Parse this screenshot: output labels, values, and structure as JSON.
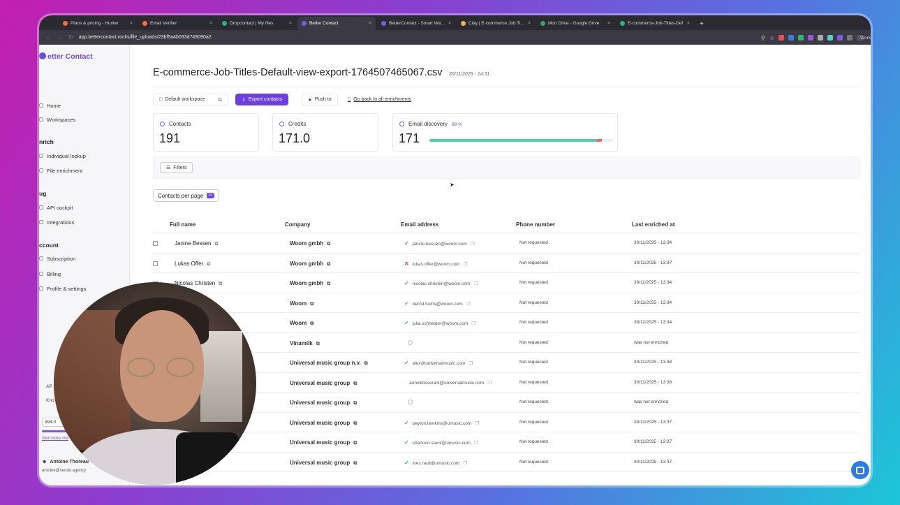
{
  "browser": {
    "tabs": [
      {
        "label": "Plans & pricing - Hunter",
        "color": "#ff6b3d",
        "active": false
      },
      {
        "label": "Email Verifier",
        "color": "#ff6b3d",
        "active": false
      },
      {
        "label": "Dropcontact | My files",
        "color": "#25b37a",
        "active": false
      },
      {
        "label": "Better Contact",
        "color": "#7b5ce6",
        "active": true
      },
      {
        "label": "BetterContact - Smart Waterf",
        "color": "#7b5ce6",
        "active": false
      },
      {
        "label": "Clay | E-commerce Job Titles",
        "color": "#f0b34a",
        "active": false
      },
      {
        "label": "Mon Drive - Google Drive",
        "color": "#3ba55c",
        "active": false
      },
      {
        "label": "E-commerce-Job-Titles-Def",
        "color": "#2bb673",
        "active": false
      }
    ],
    "url": "app.bettercontact.rocks/file_uploads/23bf5a4b033d749090a2",
    "profile": "Work"
  },
  "sidebar": {
    "logo": "etter Contact",
    "items": [
      {
        "label": "Home"
      },
      {
        "label": "Workspaces"
      },
      {
        "section": "nrich"
      },
      {
        "label": "Individual lookup"
      },
      {
        "label": "File enrichment"
      },
      {
        "section": "ug"
      },
      {
        "label": "API cockpit"
      },
      {
        "label": "Integrations"
      },
      {
        "section": "ccount"
      },
      {
        "label": "Subscription"
      },
      {
        "label": "Billing"
      },
      {
        "label": "Profile & settings"
      }
    ],
    "bottom_api": "AP",
    "bottom_kn": "Kno",
    "credits_value": "994.0",
    "get_more": "Get more cre",
    "user_name": "Antoine Thoreau",
    "user_email": "antoine@sendo.agency"
  },
  "main": {
    "file_title": "E-commerce-Job-Titles-Default-view-export-1764507465067.csv",
    "file_date": "30/11/2025 - 14:31",
    "buttons": {
      "workspace": "Default workspace",
      "export": "Export contacts",
      "push": "Push to",
      "back": "Go back to all enrichments"
    },
    "stats": {
      "contacts_label": "Contacts",
      "contacts_value": "191",
      "credits_label": "Credits",
      "credits_value": "171.0",
      "email_label": "Email discovery",
      "email_pct": "89 %",
      "email_value": "171",
      "email_found_fraction": 0.91,
      "email_failed_fraction": 0.03
    },
    "filters": "Filters",
    "per_page_label": "Contacts per page",
    "per_page_value": "25",
    "columns": [
      "Full name",
      "Company",
      "Email address",
      "Phone number",
      "Last enriched at"
    ],
    "rows": [
      {
        "name": "Janine Bessen",
        "company": "Woom gmbh",
        "status": "ok",
        "email": "janine.bessen@woom.com",
        "phone": "Not requested",
        "enriched": "30/11/2025 - 13:34"
      },
      {
        "name": "Lukas Offer",
        "company": "Woom gmbh",
        "status": "bad",
        "email": "lukas.offer@woom.com",
        "phone": "Not requested",
        "enriched": "30/11/2025 - 13:37"
      },
      {
        "name": "Nicolas Christen",
        "company": "Woom gmbh",
        "status": "ok",
        "email": "nicolas.christen@woom.com",
        "phone": "Not requested",
        "enriched": "30/11/2025 - 13:34"
      },
      {
        "name": "",
        "company": "Woom",
        "status": "ok",
        "email": "bernd.fuchs@woom.com",
        "phone": "Not requested",
        "enriched": "30/11/2025 - 13:34"
      },
      {
        "name": "",
        "company": "Woom",
        "status": "ok",
        "email": "julia.schneider@woom.com",
        "phone": "Not requested",
        "enriched": "30/11/2025 - 13:34"
      },
      {
        "name": "",
        "company": "Vinamilk",
        "status": "none",
        "email": "",
        "phone": "Not requested",
        "enriched": "was not enriched"
      },
      {
        "name": "",
        "company": "Universal music group n.v.",
        "status": "ok",
        "email": "alex@universalmusic.com",
        "phone": "Not requested",
        "enriched": "30/11/2025 - 13:38"
      },
      {
        "name": "",
        "company": "Universal music group",
        "status": "dot",
        "email": "annicktisserant@universalmusic.com",
        "phone": "Not requested",
        "enriched": "30/11/2025 - 13:38"
      },
      {
        "name": "",
        "company": "Universal music group",
        "status": "none",
        "email": "",
        "phone": "Not requested",
        "enriched": "was not enriched"
      },
      {
        "name": "",
        "company": "Universal music group",
        "status": "ok",
        "email": "peyton.lamkins@umusic.com",
        "phone": "Not requested",
        "enriched": "30/11/2025 - 13:37"
      },
      {
        "name": "",
        "company": "Universal music group",
        "status": "ok",
        "email": "shannon.stack@umusic.com",
        "phone": "Not requested",
        "enriched": "30/11/2025 - 13:37"
      },
      {
        "name": "",
        "company": "Universal music group",
        "status": "ok",
        "email": "ines.rault@umusic.com",
        "phone": "Not requested",
        "enriched": "30/11/2025 - 13:37"
      }
    ]
  }
}
